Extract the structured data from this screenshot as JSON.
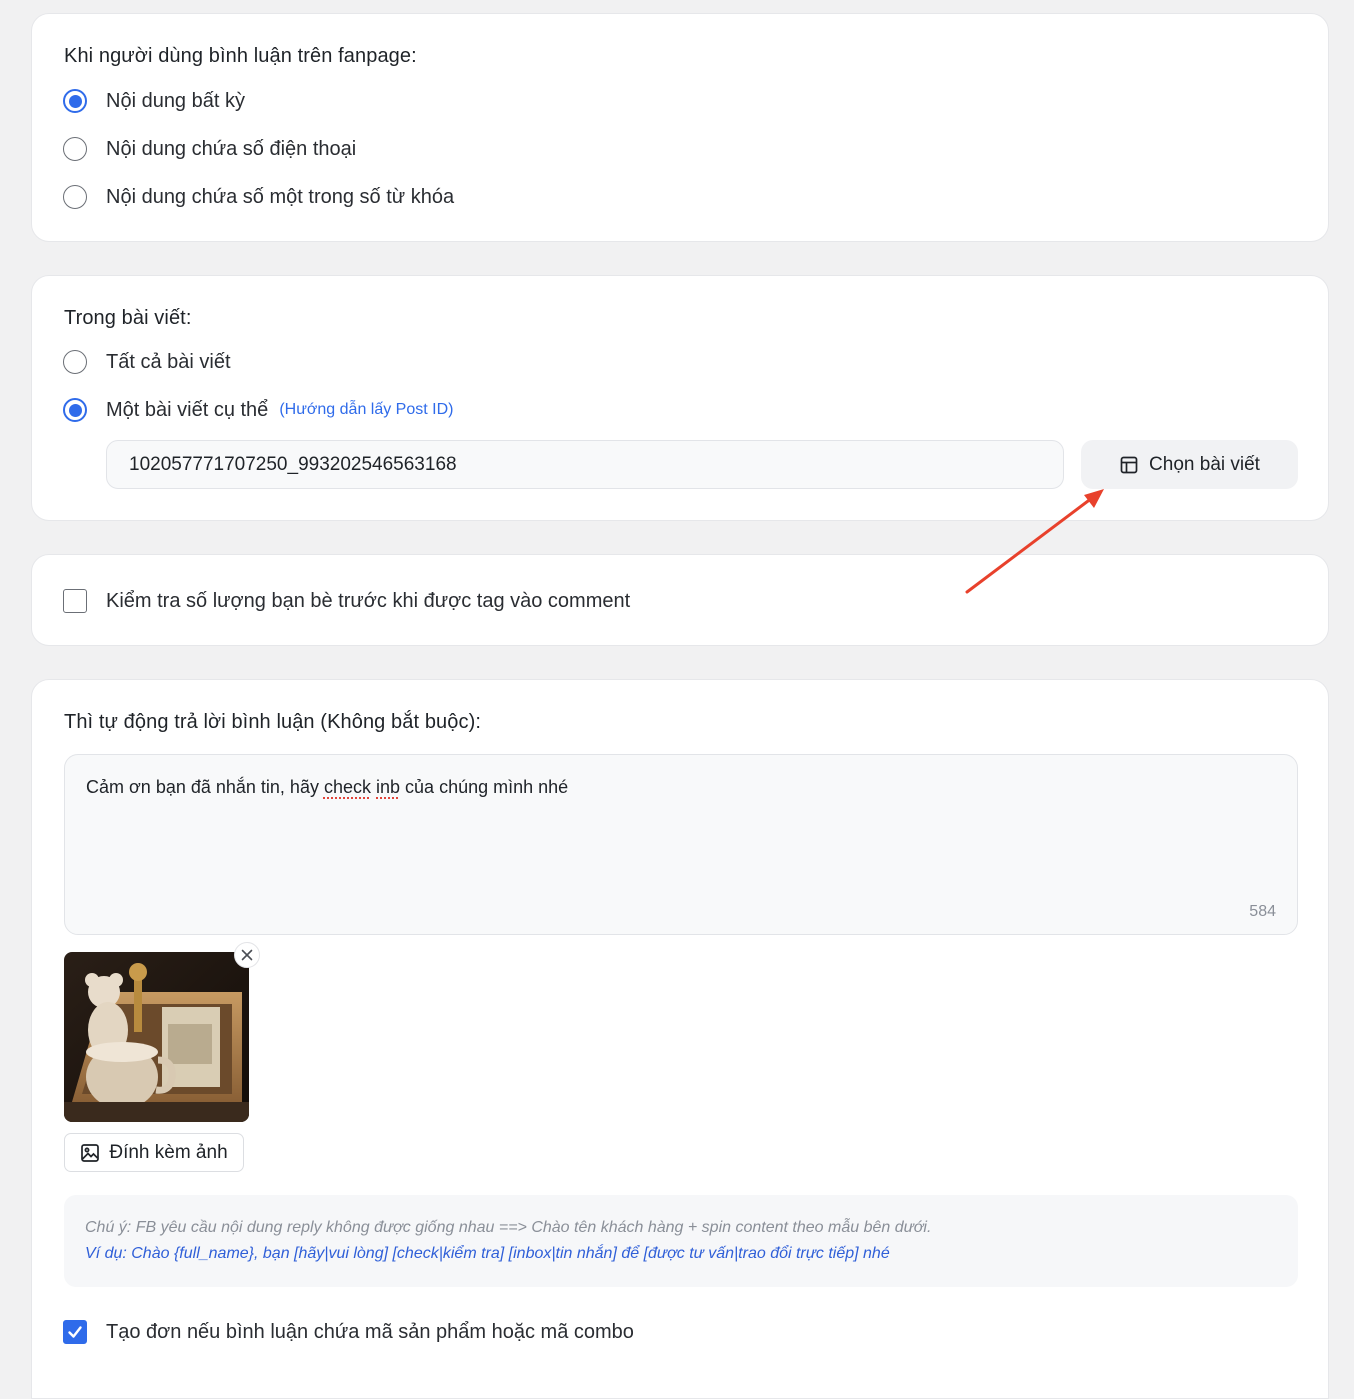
{
  "trigger_section": {
    "title": "Khi người dùng bình luận trên fanpage:",
    "options": [
      {
        "label": "Nội dung bất kỳ",
        "selected": true
      },
      {
        "label": "Nội dung chứa số điện thoại",
        "selected": false
      },
      {
        "label": "Nội dung chứa số một trong số từ khóa",
        "selected": false
      }
    ]
  },
  "post_section": {
    "title": "Trong bài viết:",
    "options": [
      {
        "label": "Tất cả bài viết",
        "selected": false
      },
      {
        "label": "Một bài viết cụ thể",
        "selected": true
      }
    ],
    "help_link": "(Hướng dẫn lấy Post ID)",
    "post_id_value": "102057771707250_993202546563168",
    "choose_button": "Chọn bài viết",
    "choose_button_icon": "layout-icon"
  },
  "friend_check": {
    "label": "Kiểm tra số lượng bạn bè trước khi được tag vào comment",
    "checked": false
  },
  "reply_section": {
    "title": "Thì tự động trả lời bình luận (Không bắt buộc):",
    "reply_text_before": "Cảm ơn bạn đã nhắn tin, hãy ",
    "reply_text_word1": "check",
    "reply_text_space": " ",
    "reply_text_word2": "inb",
    "reply_text_after": " của chúng mình nhé",
    "char_count": "584",
    "attach_button": "Đính kèm ảnh",
    "attach_icon": "image-icon",
    "remove_icon": "close-icon",
    "note_line1": "Chú ý: FB yêu cầu nội dung reply không được giống nhau ==> Chào tên khách hàng + spin content theo mẫu bên dưới.",
    "note_line2": "Ví dụ: Chào {full_name}, bạn [hãy|vui lòng] [check|kiểm tra] [inbox|tin nhắn] để [được tư vấn|trao đổi trực tiếp] nhé"
  },
  "create_order": {
    "label": "Tạo đơn nếu bình luận chứa mã sản phẩm hoặc mã combo",
    "checked": true
  },
  "colors": {
    "accent": "#2f6bea",
    "annotation_arrow": "#e8412c",
    "page_background": "#f1f1f2"
  }
}
